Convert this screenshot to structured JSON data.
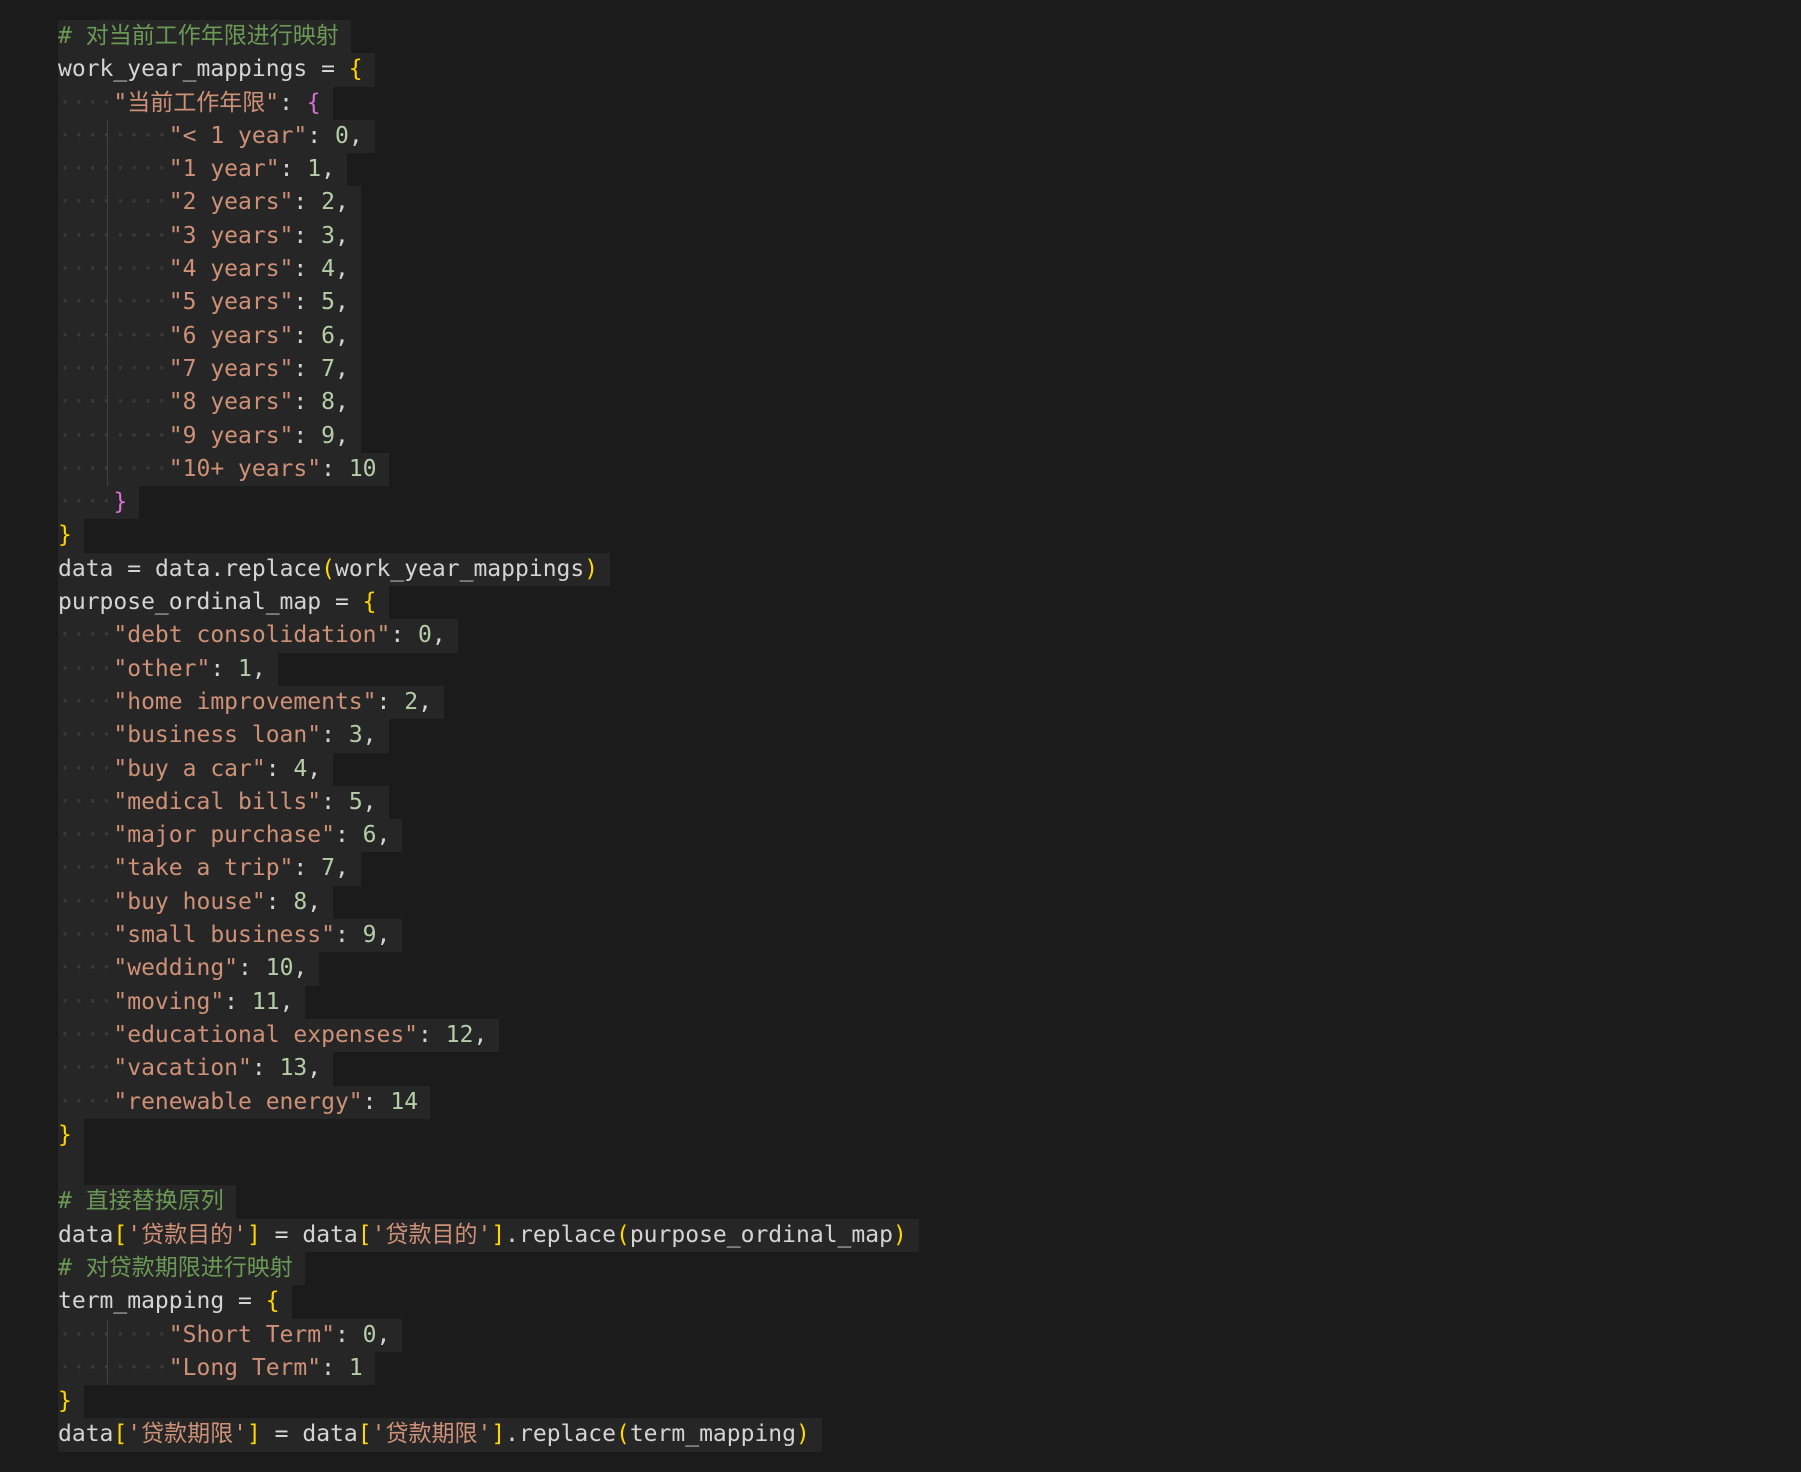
{
  "editor": {
    "lines": [
      {
        "indent": 0,
        "tokens": [
          [
            "c-comment",
            "# 对当前工作年限进行映射"
          ]
        ]
      },
      {
        "indent": 0,
        "tokens": [
          [
            "c-var",
            "work_year_mappings"
          ],
          [
            "c-punc",
            " = "
          ],
          [
            "c-brace1",
            "{"
          ]
        ]
      },
      {
        "indent": 1,
        "tokens": [
          [
            "c-str",
            "\"当前工作年限\""
          ],
          [
            "c-punc",
            ": "
          ],
          [
            "c-brace2",
            "{"
          ]
        ]
      },
      {
        "indent": 2,
        "tokens": [
          [
            "c-str",
            "\"< 1 year\""
          ],
          [
            "c-punc",
            ": "
          ],
          [
            "c-num",
            "0"
          ],
          [
            "c-punc",
            ","
          ]
        ]
      },
      {
        "indent": 2,
        "tokens": [
          [
            "c-str",
            "\"1 year\""
          ],
          [
            "c-punc",
            ": "
          ],
          [
            "c-num",
            "1"
          ],
          [
            "c-punc",
            ","
          ]
        ]
      },
      {
        "indent": 2,
        "tokens": [
          [
            "c-str",
            "\"2 years\""
          ],
          [
            "c-punc",
            ": "
          ],
          [
            "c-num",
            "2"
          ],
          [
            "c-punc",
            ","
          ]
        ]
      },
      {
        "indent": 2,
        "tokens": [
          [
            "c-str",
            "\"3 years\""
          ],
          [
            "c-punc",
            ": "
          ],
          [
            "c-num",
            "3"
          ],
          [
            "c-punc",
            ","
          ]
        ]
      },
      {
        "indent": 2,
        "tokens": [
          [
            "c-str",
            "\"4 years\""
          ],
          [
            "c-punc",
            ": "
          ],
          [
            "c-num",
            "4"
          ],
          [
            "c-punc",
            ","
          ]
        ]
      },
      {
        "indent": 2,
        "tokens": [
          [
            "c-str",
            "\"5 years\""
          ],
          [
            "c-punc",
            ": "
          ],
          [
            "c-num",
            "5"
          ],
          [
            "c-punc",
            ","
          ]
        ]
      },
      {
        "indent": 2,
        "tokens": [
          [
            "c-str",
            "\"6 years\""
          ],
          [
            "c-punc",
            ": "
          ],
          [
            "c-num",
            "6"
          ],
          [
            "c-punc",
            ","
          ]
        ]
      },
      {
        "indent": 2,
        "tokens": [
          [
            "c-str",
            "\"7 years\""
          ],
          [
            "c-punc",
            ": "
          ],
          [
            "c-num",
            "7"
          ],
          [
            "c-punc",
            ","
          ]
        ]
      },
      {
        "indent": 2,
        "tokens": [
          [
            "c-str",
            "\"8 years\""
          ],
          [
            "c-punc",
            ": "
          ],
          [
            "c-num",
            "8"
          ],
          [
            "c-punc",
            ","
          ]
        ]
      },
      {
        "indent": 2,
        "tokens": [
          [
            "c-str",
            "\"9 years\""
          ],
          [
            "c-punc",
            ": "
          ],
          [
            "c-num",
            "9"
          ],
          [
            "c-punc",
            ","
          ]
        ]
      },
      {
        "indent": 2,
        "tokens": [
          [
            "c-str",
            "\"10+ years\""
          ],
          [
            "c-punc",
            ": "
          ],
          [
            "c-num",
            "10"
          ]
        ]
      },
      {
        "indent": 1,
        "tokens": [
          [
            "c-brace2",
            "}"
          ]
        ]
      },
      {
        "indent": 0,
        "tokens": [
          [
            "c-brace1",
            "}"
          ]
        ]
      },
      {
        "indent": 0,
        "tokens": [
          [
            "c-var",
            "data"
          ],
          [
            "c-punc",
            " = "
          ],
          [
            "c-var",
            "data"
          ],
          [
            "c-punc",
            "."
          ],
          [
            "c-fn",
            "replace"
          ],
          [
            "c-paren",
            "("
          ],
          [
            "c-var",
            "work_year_mappings"
          ],
          [
            "c-paren",
            ")"
          ]
        ]
      },
      {
        "indent": 0,
        "tokens": [
          [
            "c-var",
            "purpose_ordinal_map"
          ],
          [
            "c-punc",
            " = "
          ],
          [
            "c-brace1",
            "{"
          ]
        ]
      },
      {
        "indent": 1,
        "tokens": [
          [
            "c-str",
            "\"debt consolidation\""
          ],
          [
            "c-punc",
            ": "
          ],
          [
            "c-num",
            "0"
          ],
          [
            "c-punc",
            ","
          ]
        ]
      },
      {
        "indent": 1,
        "tokens": [
          [
            "c-str",
            "\"other\""
          ],
          [
            "c-punc",
            ": "
          ],
          [
            "c-num",
            "1"
          ],
          [
            "c-punc",
            ","
          ]
        ]
      },
      {
        "indent": 1,
        "tokens": [
          [
            "c-str",
            "\"home improvements\""
          ],
          [
            "c-punc",
            ": "
          ],
          [
            "c-num",
            "2"
          ],
          [
            "c-punc",
            ","
          ]
        ]
      },
      {
        "indent": 1,
        "tokens": [
          [
            "c-str",
            "\"business loan\""
          ],
          [
            "c-punc",
            ": "
          ],
          [
            "c-num",
            "3"
          ],
          [
            "c-punc",
            ","
          ]
        ]
      },
      {
        "indent": 1,
        "tokens": [
          [
            "c-str",
            "\"buy a car\""
          ],
          [
            "c-punc",
            ": "
          ],
          [
            "c-num",
            "4"
          ],
          [
            "c-punc",
            ","
          ]
        ]
      },
      {
        "indent": 1,
        "tokens": [
          [
            "c-str",
            "\"medical bills\""
          ],
          [
            "c-punc",
            ": "
          ],
          [
            "c-num",
            "5"
          ],
          [
            "c-punc",
            ","
          ]
        ]
      },
      {
        "indent": 1,
        "tokens": [
          [
            "c-str",
            "\"major purchase\""
          ],
          [
            "c-punc",
            ": "
          ],
          [
            "c-num",
            "6"
          ],
          [
            "c-punc",
            ","
          ]
        ]
      },
      {
        "indent": 1,
        "tokens": [
          [
            "c-str",
            "\"take a trip\""
          ],
          [
            "c-punc",
            ": "
          ],
          [
            "c-num",
            "7"
          ],
          [
            "c-punc",
            ","
          ]
        ]
      },
      {
        "indent": 1,
        "tokens": [
          [
            "c-str",
            "\"buy house\""
          ],
          [
            "c-punc",
            ": "
          ],
          [
            "c-num",
            "8"
          ],
          [
            "c-punc",
            ","
          ]
        ]
      },
      {
        "indent": 1,
        "tokens": [
          [
            "c-str",
            "\"small business\""
          ],
          [
            "c-punc",
            ": "
          ],
          [
            "c-num",
            "9"
          ],
          [
            "c-punc",
            ","
          ]
        ]
      },
      {
        "indent": 1,
        "tokens": [
          [
            "c-str",
            "\"wedding\""
          ],
          [
            "c-punc",
            ": "
          ],
          [
            "c-num",
            "10"
          ],
          [
            "c-punc",
            ","
          ]
        ]
      },
      {
        "indent": 1,
        "tokens": [
          [
            "c-str",
            "\"moving\""
          ],
          [
            "c-punc",
            ": "
          ],
          [
            "c-num",
            "11"
          ],
          [
            "c-punc",
            ","
          ]
        ]
      },
      {
        "indent": 1,
        "tokens": [
          [
            "c-str",
            "\"educational expenses\""
          ],
          [
            "c-punc",
            ": "
          ],
          [
            "c-num",
            "12"
          ],
          [
            "c-punc",
            ","
          ]
        ]
      },
      {
        "indent": 1,
        "tokens": [
          [
            "c-str",
            "\"vacation\""
          ],
          [
            "c-punc",
            ": "
          ],
          [
            "c-num",
            "13"
          ],
          [
            "c-punc",
            ","
          ]
        ]
      },
      {
        "indent": 1,
        "tokens": [
          [
            "c-str",
            "\"renewable energy\""
          ],
          [
            "c-punc",
            ": "
          ],
          [
            "c-num",
            "14"
          ]
        ]
      },
      {
        "indent": 0,
        "tokens": [
          [
            "c-brace1",
            "}"
          ]
        ]
      },
      {
        "indent": 0,
        "tokens": [
          [
            "c-punc",
            ""
          ]
        ]
      },
      {
        "indent": 0,
        "tokens": [
          [
            "c-comment",
            "# 直接替换原列"
          ]
        ]
      },
      {
        "indent": 0,
        "tokens": [
          [
            "c-var",
            "data"
          ],
          [
            "c-bracket",
            "["
          ],
          [
            "c-str",
            "'贷款目的'"
          ],
          [
            "c-bracket",
            "]"
          ],
          [
            "c-punc",
            " = "
          ],
          [
            "c-var",
            "data"
          ],
          [
            "c-bracket",
            "["
          ],
          [
            "c-str",
            "'贷款目的'"
          ],
          [
            "c-bracket",
            "]"
          ],
          [
            "c-punc",
            "."
          ],
          [
            "c-fn",
            "replace"
          ],
          [
            "c-paren",
            "("
          ],
          [
            "c-var",
            "purpose_ordinal_map"
          ],
          [
            "c-paren",
            ")"
          ]
        ]
      },
      {
        "indent": 0,
        "tokens": [
          [
            "c-comment",
            "# 对贷款期限进行映射"
          ]
        ]
      },
      {
        "indent": 0,
        "tokens": [
          [
            "c-var",
            "term_mapping"
          ],
          [
            "c-punc",
            " = "
          ],
          [
            "c-brace1",
            "{"
          ]
        ]
      },
      {
        "indent": 2,
        "tokens": [
          [
            "c-str",
            "\"Short Term\""
          ],
          [
            "c-punc",
            ": "
          ],
          [
            "c-num",
            "0"
          ],
          [
            "c-punc",
            ","
          ]
        ]
      },
      {
        "indent": 2,
        "tokens": [
          [
            "c-str",
            "\"Long Term\""
          ],
          [
            "c-punc",
            ": "
          ],
          [
            "c-num",
            "1"
          ]
        ]
      },
      {
        "indent": 0,
        "tokens": [
          [
            "c-brace1",
            "}"
          ]
        ]
      },
      {
        "indent": 0,
        "tokens": [
          [
            "c-var",
            "data"
          ],
          [
            "c-bracket",
            "["
          ],
          [
            "c-str",
            "'贷款期限'"
          ],
          [
            "c-bracket",
            "]"
          ],
          [
            "c-punc",
            " = "
          ],
          [
            "c-var",
            "data"
          ],
          [
            "c-bracket",
            "["
          ],
          [
            "c-str",
            "'贷款期限'"
          ],
          [
            "c-bracket",
            "]"
          ],
          [
            "c-punc",
            "."
          ],
          [
            "c-fn",
            "replace"
          ],
          [
            "c-paren",
            "("
          ],
          [
            "c-var",
            "term_mapping"
          ],
          [
            "c-paren",
            ")"
          ]
        ]
      }
    ]
  }
}
